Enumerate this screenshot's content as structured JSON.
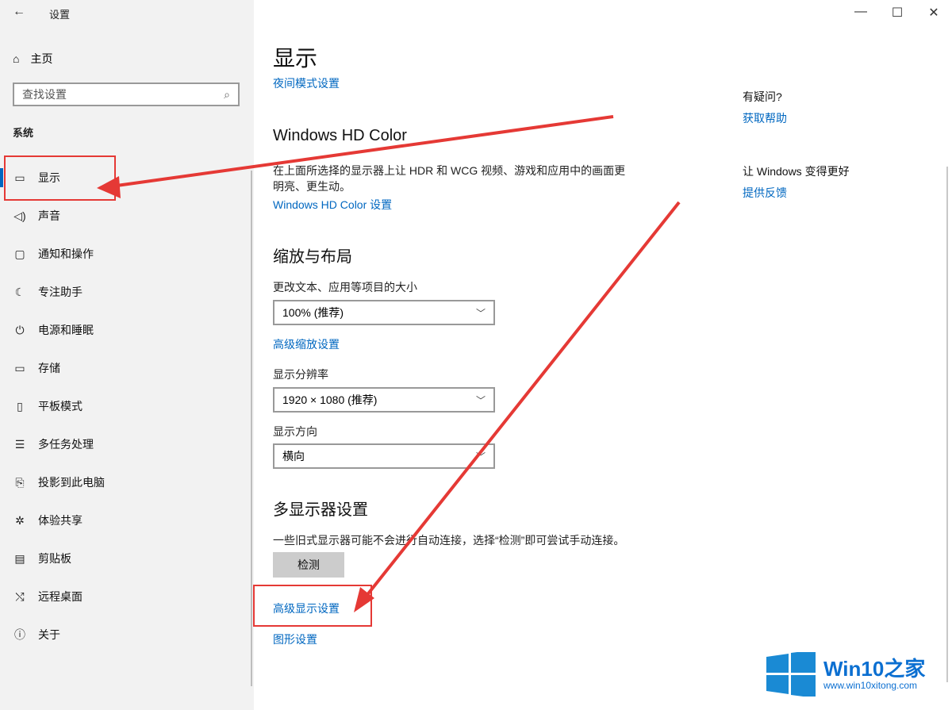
{
  "window": {
    "title": "设置",
    "controls": {
      "minimize": "—",
      "maximize": "☐",
      "close": "✕"
    }
  },
  "sidebar": {
    "home_label": "主页",
    "search_placeholder": "查找设置",
    "section_label": "系统",
    "items": [
      {
        "label": "显示",
        "icon": "monitor-icon",
        "glyph": "▭"
      },
      {
        "label": "声音",
        "icon": "speaker-icon",
        "glyph": "🔈"
      },
      {
        "label": "通知和操作",
        "icon": "notification-icon",
        "glyph": "▢"
      },
      {
        "label": "专注助手",
        "icon": "moon-icon",
        "glyph": "☾"
      },
      {
        "label": "电源和睡眠",
        "icon": "power-icon",
        "glyph": "⏻"
      },
      {
        "label": "存储",
        "icon": "storage-icon",
        "glyph": "▭"
      },
      {
        "label": "平板模式",
        "icon": "tablet-icon",
        "glyph": "▯"
      },
      {
        "label": "多任务处理",
        "icon": "multitask-icon",
        "glyph": "☰"
      },
      {
        "label": "投影到此电脑",
        "icon": "projection-icon",
        "glyph": "⎘"
      },
      {
        "label": "体验共享",
        "icon": "share-icon",
        "glyph": "✲"
      },
      {
        "label": "剪贴板",
        "icon": "clipboard-icon",
        "glyph": "📋"
      },
      {
        "label": "远程桌面",
        "icon": "remote-icon",
        "glyph": "✕"
      },
      {
        "label": "关于",
        "icon": "info-icon",
        "glyph": "ⓘ"
      }
    ]
  },
  "main": {
    "title": "显示",
    "night_light_link": "夜间模式设置",
    "hdr": {
      "heading": "Windows HD Color",
      "description_line1": "在上面所选择的显示器上让 HDR 和 WCG 视频、游戏和应用中的画面更",
      "description_line2": "明亮、更生动。",
      "link": "Windows HD Color 设置"
    },
    "scale": {
      "heading": "缩放与布局",
      "size_label": "更改文本、应用等项目的大小",
      "size_value": "100% (推荐)",
      "advanced_link": "高级缩放设置",
      "resolution_label": "显示分辨率",
      "resolution_value": "1920 × 1080 (推荐)",
      "orientation_label": "显示方向",
      "orientation_value": "横向"
    },
    "multi": {
      "heading": "多显示器设置",
      "description": "一些旧式显示器可能不会进行自动连接，选择“检测”即可尝试手动连接。",
      "detect_button": "检测",
      "advanced_display_link": "高级显示设置",
      "graphics_link": "图形设置"
    }
  },
  "aside": {
    "question_heading": "有疑问?",
    "help_link": "获取帮助",
    "improve_heading": "让 Windows 变得更好",
    "feedback_link": "提供反馈"
  },
  "watermark": {
    "brand": "Win10之家",
    "url": "www.win10xitong.com"
  },
  "annotation_color": "#e53935",
  "accent_color": "#0067c0"
}
